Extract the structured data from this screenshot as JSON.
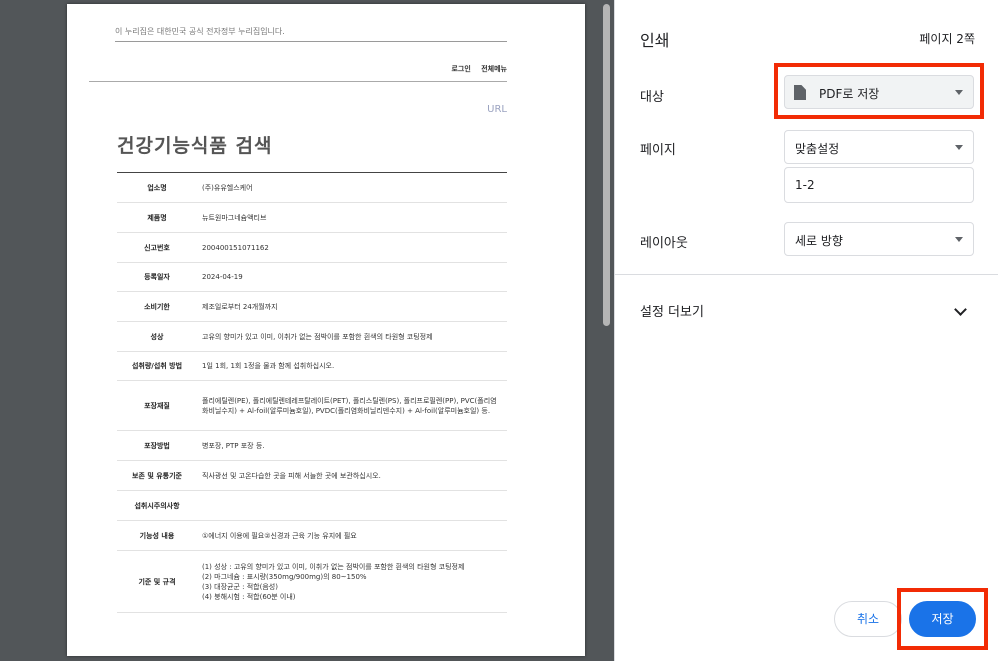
{
  "document": {
    "gov_banner": "이 누리집은 대한민국 공식 전자정부 누리집입니다.",
    "util_links": [
      "로그인",
      "전체메뉴"
    ],
    "url_text": "URL",
    "title": "건강기능식품 검색",
    "rows": [
      {
        "label": "업소명",
        "value": "(주)유유헬스케어"
      },
      {
        "label": "제품명",
        "value": "뉴트원마그네슘액티브"
      },
      {
        "label": "신고번호",
        "value": "200400151071162"
      },
      {
        "label": "등록일자",
        "value": "2024-04-19"
      },
      {
        "label": "소비기한",
        "value": "제조일로부터 24개월까지"
      },
      {
        "label": "성상",
        "value": "고유의 향미가 있고 이미, 이취가 없는 점박이를 포함한 흰색의 타원형 코팅정제"
      },
      {
        "label": "섭취량/섭취 방법",
        "value": "1일 1회, 1회 1정을 물과 함께 섭취하십시오."
      },
      {
        "label": "포장재질",
        "value": "폴리에틸렌(PE), 폴리에틸렌테레프탈레이트(PET), 폴리스틸렌(PS), 폴리프로필렌(PP), PVC(폴리염화비닐수지) + Al-foil(알루미늄호일), PVDC(폴리염화비닐리덴수지) + Al-foil(알루미늄호일) 등."
      },
      {
        "label": "포장방법",
        "value": "병포장, PTP 포장 등."
      },
      {
        "label": "보존 및 유통기준",
        "value": "직사광선 및 고온다습한 곳을 피해 서늘한 곳에 보관하십시오."
      },
      {
        "label": "섭취시주의사항",
        "value": ""
      },
      {
        "label": "기능성 내용",
        "value": "①에너지 이용에 필요②신경과 근육 기능 유지에 필요"
      },
      {
        "label": "기준 및 규격",
        "value": "(1) 성상 : 고유의 향미가 있고 이미, 이취가 없는 점박이를 포함한 흰색의 타원형 코팅정제\n(2) 마그네슘 : 표시량(350mg/900mg)의 80~150%\n(3) 대장균군 : 적합(음성)\n(4) 붕해시험 : 적합(60분 이내)"
      }
    ]
  },
  "print_panel": {
    "title": "인쇄",
    "page_count": "페이지 2쪽",
    "destination": {
      "label": "대상",
      "value": "PDF로 저장",
      "icon": "file-icon"
    },
    "pages": {
      "label": "페이지",
      "value": "맞춤설정",
      "range": "1-2"
    },
    "layout": {
      "label": "레이아웃",
      "value": "세로 방향"
    },
    "more_settings": "설정 더보기",
    "cancel_label": "취소",
    "save_label": "저장",
    "accent_color": "#1a73e8",
    "highlight_color": "#f22b05"
  }
}
